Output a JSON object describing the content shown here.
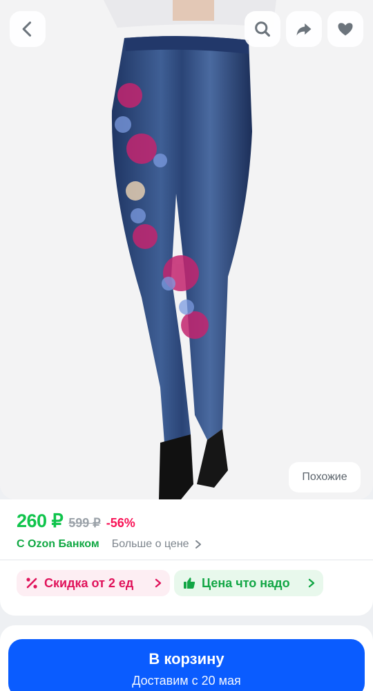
{
  "topbar": {
    "icons": [
      "chevron-left-icon",
      "search-icon",
      "share-icon",
      "heart-icon"
    ]
  },
  "gallery": {
    "similar_label": "Похожие"
  },
  "price": {
    "current": "260 ₽",
    "old": "599 ₽",
    "discount": "-56%",
    "bank_label": "С Ozon Банком",
    "more_label": "Больше о цене"
  },
  "chips": [
    {
      "label": "Скидка от 2 ед",
      "icon": "percent-icon"
    },
    {
      "label": "Цена что надо",
      "icon": "thumbs-up-icon"
    }
  ],
  "cart": {
    "label": "В корзину",
    "delivery": "Доставим с 20 мая"
  },
  "colors": {
    "price_green": "#10c44c",
    "discount_pink": "#f91155",
    "cart_blue": "#0a5cff"
  }
}
